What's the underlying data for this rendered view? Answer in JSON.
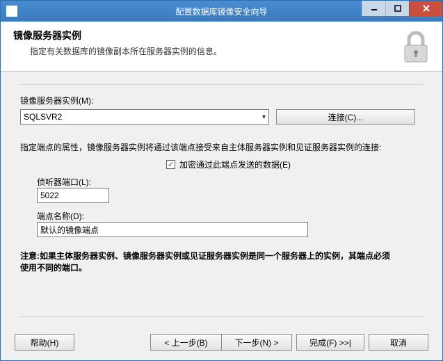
{
  "window": {
    "title": "配置数据库镜像安全向导"
  },
  "header": {
    "title": "镜像服务器实例",
    "subtitle": "指定有关数据库的镜像副本所在服务器实例的信息。"
  },
  "fields": {
    "instance_label": "镜像服务器实例(M):",
    "instance_value": "SQLSVR2",
    "connect_btn": "连接(C)...",
    "endpoint_intro": "指定端点的属性，镜像服务器实例将通过该端点接受来自主体服务器实例和见证服务器实例的连接:",
    "encrypt_label": "加密通过此端点发送的数据(E)",
    "encrypt_checked": true,
    "port_label": "侦听器端口(L):",
    "port_value": "5022",
    "endpoint_name_label": "端点名称(D):",
    "endpoint_name_value": "默认的镜像端点"
  },
  "note": {
    "prefix": "注意:",
    "text": "如果主体服务器实例、镜像服务器实例或见证服务器实例是同一个服务器上的实例，其端点必须使用不同的端口。"
  },
  "footer": {
    "help": "帮助(H)",
    "back": "< 上一步(B)",
    "next": "下一步(N) >",
    "finish": "完成(F) >>|",
    "cancel": "取消"
  }
}
